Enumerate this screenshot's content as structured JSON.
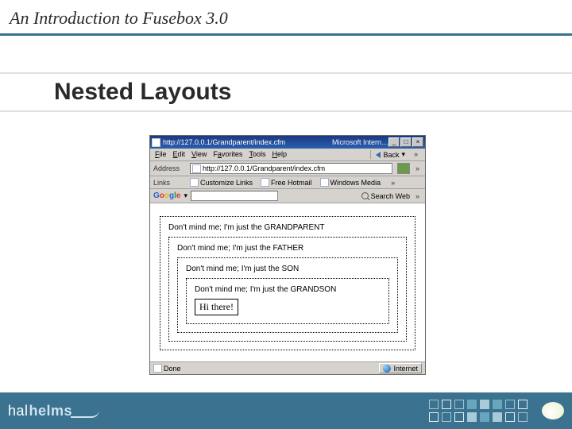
{
  "header": {
    "title": "An Introduction to Fusebox 3.0"
  },
  "subtitle": "Nested Layouts",
  "browser": {
    "title_url": "http://127.0.0.1/Grandparent/index.cfm",
    "title_suffix": "Microsoft Intern…",
    "menus": {
      "file": "File",
      "edit": "Edit",
      "view": "View",
      "favorites": "Favorites",
      "tools": "Tools",
      "help": "Help"
    },
    "back_label": "Back",
    "address_label": "Address",
    "address_value": "http://127.0.0.1/Grandparent/index.cfm",
    "links_label": "Links",
    "link_items": [
      "Customize Links",
      "Free Hotmail",
      "Windows Media"
    ],
    "google_label": "Google",
    "search_label": "Search Web",
    "chevron": "»",
    "window_controls": {
      "min": "_",
      "max": "□",
      "close": "×"
    }
  },
  "nested": {
    "grandparent": "Don't mind me; I'm just the GRANDPARENT",
    "father": "Don't mind me; I'm just the FATHER",
    "son": "Don't mind me; I'm just the SON",
    "grandson": "Don't mind me; I'm just the GRANDSON",
    "content": "Hi there!"
  },
  "statusbar": {
    "done": "Done",
    "zone": "Internet"
  },
  "footer": {
    "logo_left": "hal",
    "logo_right": "helms"
  }
}
